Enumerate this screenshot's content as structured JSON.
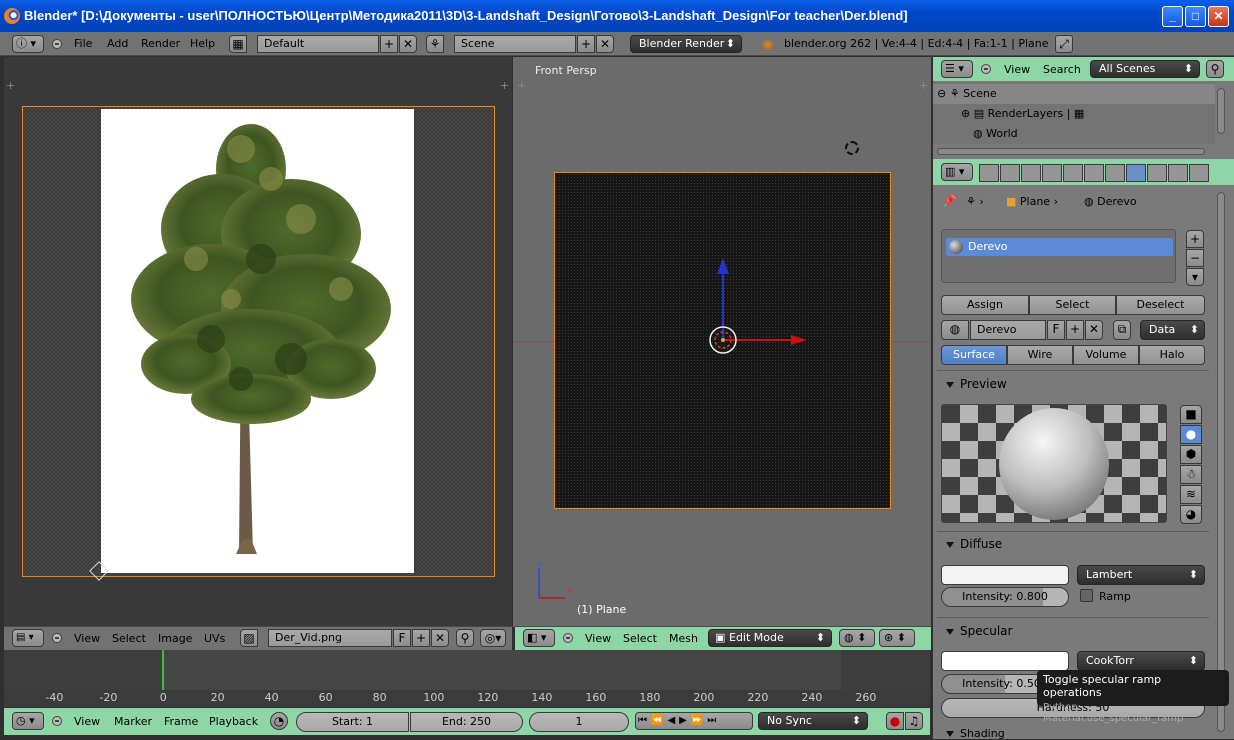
{
  "window": {
    "title": "Blender* [D:\\Документы - user\\ПОЛНОСТЬЮ\\Центр\\Методика2011\\3D\\3-Landshaft_Design\\Готово\\3-Landshaft_Design\\For teacher\\Der.blend]",
    "min_label": "_",
    "max_label": "□",
    "close_label": "✕"
  },
  "topbar": {
    "menus": [
      "File",
      "Add",
      "Render",
      "Help"
    ],
    "layout": "Default",
    "scene": "Scene",
    "engine": "Blender Render",
    "stats": "blender.org 262 | Ve:4-4 | Ed:4-4 | Fa:1-1 | Plane"
  },
  "image_editor": {
    "menus": [
      "View",
      "Select",
      "Image",
      "UVs"
    ],
    "image_name": "Der_Vid.png",
    "fake_user": "F"
  },
  "view3d": {
    "view_label": "Front Persp",
    "object_label": "(1) Plane",
    "axis_x": "x",
    "axis_z": "z",
    "menus": [
      "View",
      "Select",
      "Mesh"
    ],
    "mode": "Edit Mode"
  },
  "timeline": {
    "ticks": [
      "-40",
      "-20",
      "0",
      "20",
      "40",
      "60",
      "80",
      "100",
      "120",
      "140",
      "160",
      "180",
      "200",
      "220",
      "240",
      "260"
    ],
    "menus": [
      "View",
      "Marker",
      "Frame",
      "Playback"
    ],
    "start": "Start: 1",
    "end": "End: 250",
    "current": "1",
    "sync": "No Sync"
  },
  "outliner": {
    "menus": [
      "View",
      "Search"
    ],
    "filter": "All Scenes",
    "items": [
      "Scene",
      "RenderLayers",
      "World"
    ]
  },
  "properties": {
    "breadcrumb": [
      "Plane",
      "Derevo"
    ],
    "material_slot": "Derevo",
    "slot_buttons": [
      "Assign",
      "Select",
      "Deselect"
    ],
    "material_name": "Derevo",
    "fake_user": "F",
    "link": "Data",
    "type_tabs": [
      "Surface",
      "Wire",
      "Volume",
      "Halo"
    ],
    "preview_title": "Preview",
    "diffuse_title": "Diffuse",
    "diffuse_shader": "Lambert",
    "diffuse_intensity": "Intensity: 0.800",
    "ramp_label": "Ramp",
    "specular_title": "Specular",
    "specular_shader": "CookTorr",
    "specular_intensity": "Intensity: 0.500",
    "hardness": "Hardness: 50",
    "shading_title": "Shading"
  },
  "tooltip": {
    "title": "Toggle specular ramp operations",
    "python": "Python: Material.use_specular_ramp"
  }
}
